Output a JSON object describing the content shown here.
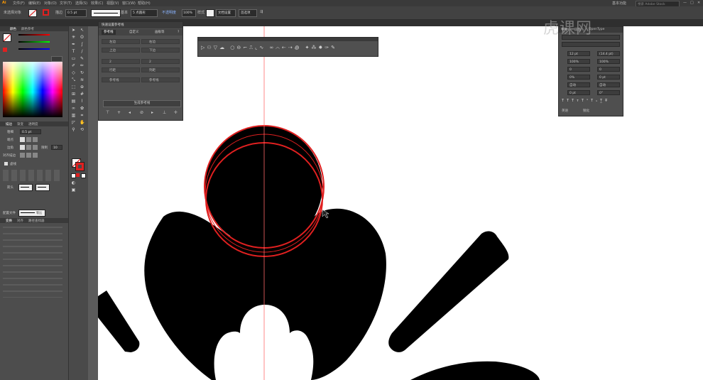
{
  "app": {
    "name": "Adobe Illustrator",
    "logo": "Ai"
  },
  "menubar": {
    "items": [
      "文件(F)",
      "编辑(E)",
      "对象(O)",
      "文字(T)",
      "选择(S)",
      "效果(C)",
      "视图(V)",
      "窗口(W)",
      "帮助(H)"
    ],
    "workspace": "基本功能",
    "search_placeholder": "搜索 Adobe Stock"
  },
  "control_bar": {
    "selection_label": "未选择对象",
    "stroke_label": "描边",
    "stroke_value": "0.5 pt",
    "brush_label": "基本",
    "style_label": "5 点圆形",
    "opacity_label": "不透明度",
    "opacity_value": "100%",
    "style2_label": "样式",
    "doc_setup": "文档设置",
    "prefs": "首选项"
  },
  "left_panel": {
    "color_tabs": [
      "颜色",
      "颜色参考"
    ],
    "stroke_tabs": [
      "描边",
      "渐变",
      "透明度"
    ],
    "weight_label": "粗细",
    "weight_value": "0.5 pt",
    "cap_label": "端点",
    "corner_label": "边角",
    "limit_label": "限制",
    "limit_value": "10",
    "align_label": "对齐描边",
    "dashed_label": "虚线",
    "arrow_label": "箭头",
    "profile_label": "配置文件",
    "profile_value": "等比",
    "transform_tabs": [
      "变换",
      "对齐",
      "路径查找器"
    ]
  },
  "guides_panel": {
    "title": "快速设置参考线",
    "tabs": [
      "参考线",
      "自定义",
      "画板等"
    ],
    "fields": [
      {
        "label": "左边",
        "value": "0"
      },
      {
        "label": "右边",
        "value": "0"
      },
      {
        "label": "上边",
        "value": "0"
      },
      {
        "label": "下边",
        "value": "0"
      },
      {
        "label": "行数",
        "value": "2"
      },
      {
        "label": "列数",
        "value": "2"
      },
      {
        "label": "行距",
        "value": "0"
      },
      {
        "label": "列距",
        "value": "0"
      },
      {
        "label": "参考线",
        "value": ""
      },
      {
        "label": "参考线",
        "value": ""
      }
    ],
    "button": "生成参考线"
  },
  "char_panel": {
    "tabs": [
      "字符",
      "段落",
      "OpenType"
    ],
    "fields": [
      "12 pt",
      "(14.4 pt)",
      "100%",
      "100%",
      "0",
      "0",
      "0%",
      "0 pt",
      "自动",
      "自动",
      "0 pt",
      "0°"
    ],
    "lang": "英语",
    "aa": "锐化"
  },
  "watermark": "虎课网",
  "colors": {
    "canvas": "#ffffff",
    "shape": "#000000",
    "selection": "#e02020",
    "guide": "#ff5a5a",
    "ui_dark": "#3a3a3a",
    "ui_mid": "#535353"
  }
}
